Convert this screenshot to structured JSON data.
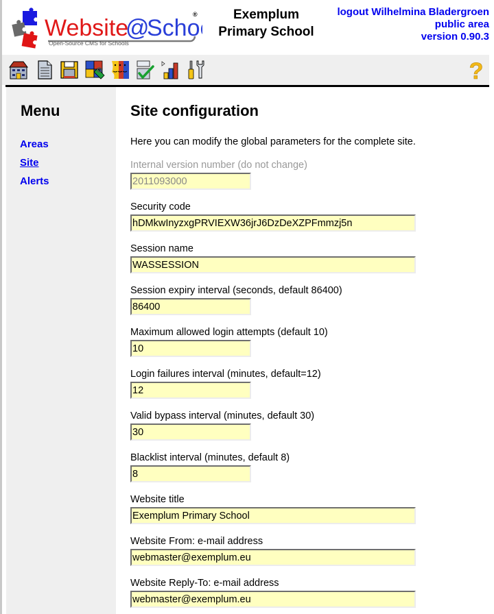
{
  "header": {
    "logo_text_left": "Website",
    "logo_text_at": "@",
    "logo_text_right": "School",
    "logo_tagline": "Open-Source CMS for Schools",
    "site_name_line1": "Exemplum",
    "site_name_line2": "Primary School",
    "logout_label": "logout Wilhelmina Bladergroen",
    "area_label": "public area",
    "version_label": "version 0.90.3"
  },
  "toolbar": {
    "items": [
      {
        "icon": "home-icon",
        "title": "Start"
      },
      {
        "icon": "page-icon",
        "title": "Pagemanager"
      },
      {
        "icon": "floppy-disk-icon",
        "title": "File manager"
      },
      {
        "icon": "puzzle-lock-icon",
        "title": "Modules"
      },
      {
        "icon": "users-faces-icon",
        "title": "Account manager"
      },
      {
        "icon": "checkbox-check-icon",
        "title": "Configuration manager"
      },
      {
        "icon": "statistics-bars-icon",
        "title": "Statistics"
      },
      {
        "icon": "tools-icon",
        "title": "Tools"
      }
    ],
    "help_icon": "help-question-icon"
  },
  "sidebar": {
    "title": "Menu",
    "items": [
      {
        "label": "Areas",
        "active": false
      },
      {
        "label": "Site",
        "active": true
      },
      {
        "label": "Alerts",
        "active": false
      }
    ]
  },
  "main": {
    "title": "Site configuration",
    "intro": "Here you can modify the global parameters for the complete site.",
    "fields": [
      {
        "label": "Internal version number (do not change)",
        "value": "2011093000",
        "disabled": true
      },
      {
        "label": "Security code",
        "value": "hDMkwInyzxgPRVIEXW36jrJ6DzDeXZPFmmzj5n"
      },
      {
        "label": "Session name",
        "value": "WASSESSION"
      },
      {
        "label": "Session expiry interval (seconds, default 86400)",
        "value": "86400"
      },
      {
        "label": "Maximum allowed login attempts (default 10)",
        "value": "10"
      },
      {
        "label": "Login failures interval (minutes, default=12)",
        "value": "12"
      },
      {
        "label": "Valid bypass interval (minutes, default 30)",
        "value": "30"
      },
      {
        "label": "Blacklist interval (minutes, default 8)",
        "value": "8"
      },
      {
        "label": "Website title",
        "value": "Exemplum Primary School"
      },
      {
        "label": "Website From: e-mail address",
        "value": "webmaster@exemplum.eu"
      },
      {
        "label": "Website Reply-To: e-mail address",
        "value": "webmaster@exemplum.eu"
      }
    ]
  },
  "colors": {
    "link": "#0000ee",
    "input_bg": "#ffffc0",
    "panel_bg": "#efefef"
  }
}
